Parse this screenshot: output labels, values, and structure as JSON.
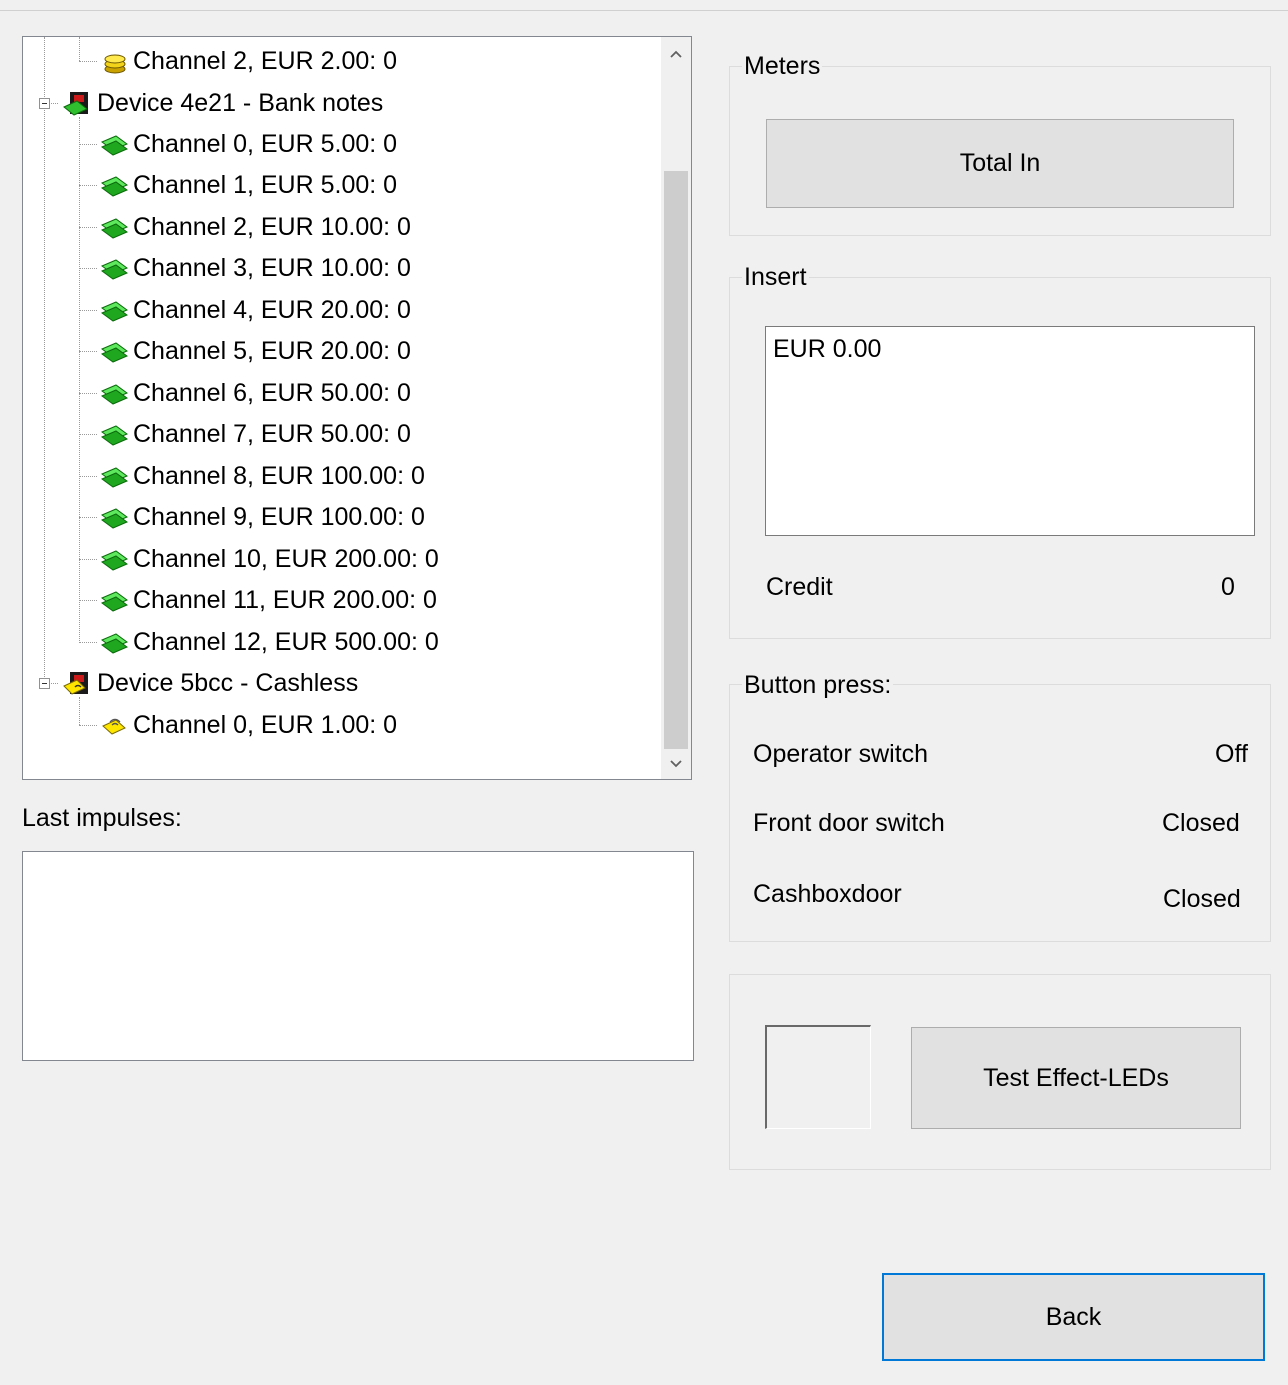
{
  "tree": {
    "items": [
      {
        "label": "Channel 2, EUR 2.00: 0",
        "icon": "coin-stack-icon"
      },
      {
        "label": "Device 4e21 - Bank notes",
        "icon": "banknote-device-icon"
      },
      {
        "label": "Channel 0, EUR 5.00: 0",
        "icon": "banknote-icon"
      },
      {
        "label": "Channel 1, EUR 5.00: 0",
        "icon": "banknote-icon"
      },
      {
        "label": "Channel 2, EUR 10.00: 0",
        "icon": "banknote-icon"
      },
      {
        "label": "Channel 3, EUR 10.00: 0",
        "icon": "banknote-icon"
      },
      {
        "label": "Channel 4, EUR 20.00: 0",
        "icon": "banknote-icon"
      },
      {
        "label": "Channel 5, EUR 20.00: 0",
        "icon": "banknote-icon"
      },
      {
        "label": "Channel 6, EUR 50.00: 0",
        "icon": "banknote-icon"
      },
      {
        "label": "Channel 7, EUR 50.00: 0",
        "icon": "banknote-icon"
      },
      {
        "label": "Channel 8, EUR 100.00: 0",
        "icon": "banknote-icon"
      },
      {
        "label": "Channel 9, EUR 100.00: 0",
        "icon": "banknote-icon"
      },
      {
        "label": "Channel 10, EUR 200.00: 0",
        "icon": "banknote-icon"
      },
      {
        "label": "Channel 11, EUR 200.00: 0",
        "icon": "banknote-icon"
      },
      {
        "label": "Channel 12, EUR 500.00: 0",
        "icon": "banknote-icon"
      },
      {
        "label": "Device 5bcc - Cashless",
        "icon": "cashless-device-icon"
      },
      {
        "label": "Channel 0, EUR 1.00: 0",
        "icon": "cashless-card-icon"
      }
    ]
  },
  "last_impulses": {
    "label": "Last impulses:",
    "value": ""
  },
  "meters": {
    "title": "Meters",
    "total_in_label": "Total In"
  },
  "insert": {
    "title": "Insert",
    "amount_text": "EUR 0.00",
    "credit_label": "Credit",
    "credit_value": "0"
  },
  "button_press": {
    "title": "Button press:",
    "operator_label": "Operator switch",
    "operator_value": "Off",
    "front_door_label": "Front door switch",
    "front_door_value": "Closed",
    "cashbox_label": "Cashboxdoor",
    "cashbox_value": "Closed"
  },
  "effects": {
    "test_led_label": "Test Effect-LEDs"
  },
  "footer": {
    "back_label": "Back"
  },
  "colors": {
    "window_bg": "#f0f0f0",
    "focus_border": "#0078d7",
    "button_bg": "#e1e1e1"
  }
}
